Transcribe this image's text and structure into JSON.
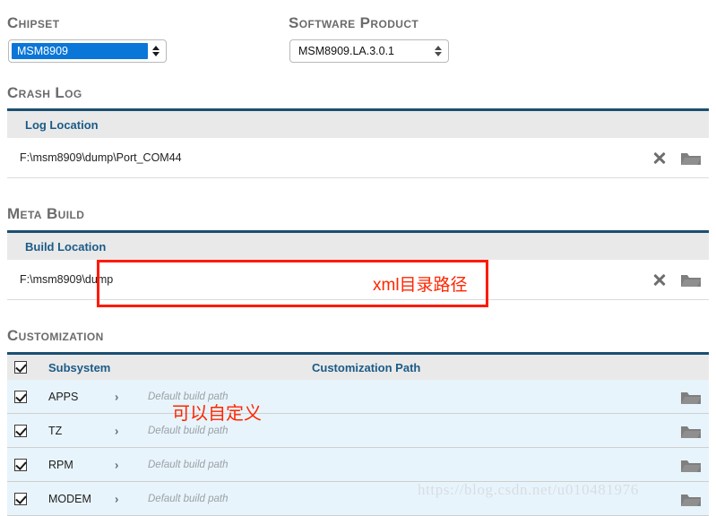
{
  "chipset": {
    "label": "Chipset",
    "value": "MSM8909",
    "selected": true
  },
  "software_product": {
    "label": "Software Product",
    "value": "MSM8909.LA.3.0.1"
  },
  "crash_log": {
    "title": "Crash Log",
    "column_header": "Log Location",
    "rows": [
      {
        "path": "F:\\msm8909\\dump\\Port_COM44"
      }
    ]
  },
  "meta_build": {
    "title": "Meta Build",
    "column_header": "Build Location",
    "rows": [
      {
        "path": "F:\\msm8909\\dump"
      }
    ]
  },
  "customization": {
    "title": "Customization",
    "columns": {
      "subsystem": "Subsystem",
      "customization_path": "Customization Path"
    },
    "select_all_checked": true,
    "rows": [
      {
        "name": "APPS",
        "checked": true,
        "expander": "›",
        "path_placeholder": "Default build path"
      },
      {
        "name": "TZ",
        "checked": true,
        "expander": "›",
        "path_placeholder": "Default build path"
      },
      {
        "name": "RPM",
        "checked": true,
        "expander": "›",
        "path_placeholder": "Default build path"
      },
      {
        "name": "MODEM",
        "checked": true,
        "expander": "›",
        "path_placeholder": "Default build path"
      }
    ]
  },
  "annotations": {
    "xml_path_note": "xml目录路径",
    "customizable_note": "可以自定义",
    "box_color": "#ff1a00"
  },
  "watermark": {
    "text": "https://blog.csdn.net/u010481976"
  },
  "icons": {
    "clear": "close-x",
    "browse": "folder"
  }
}
